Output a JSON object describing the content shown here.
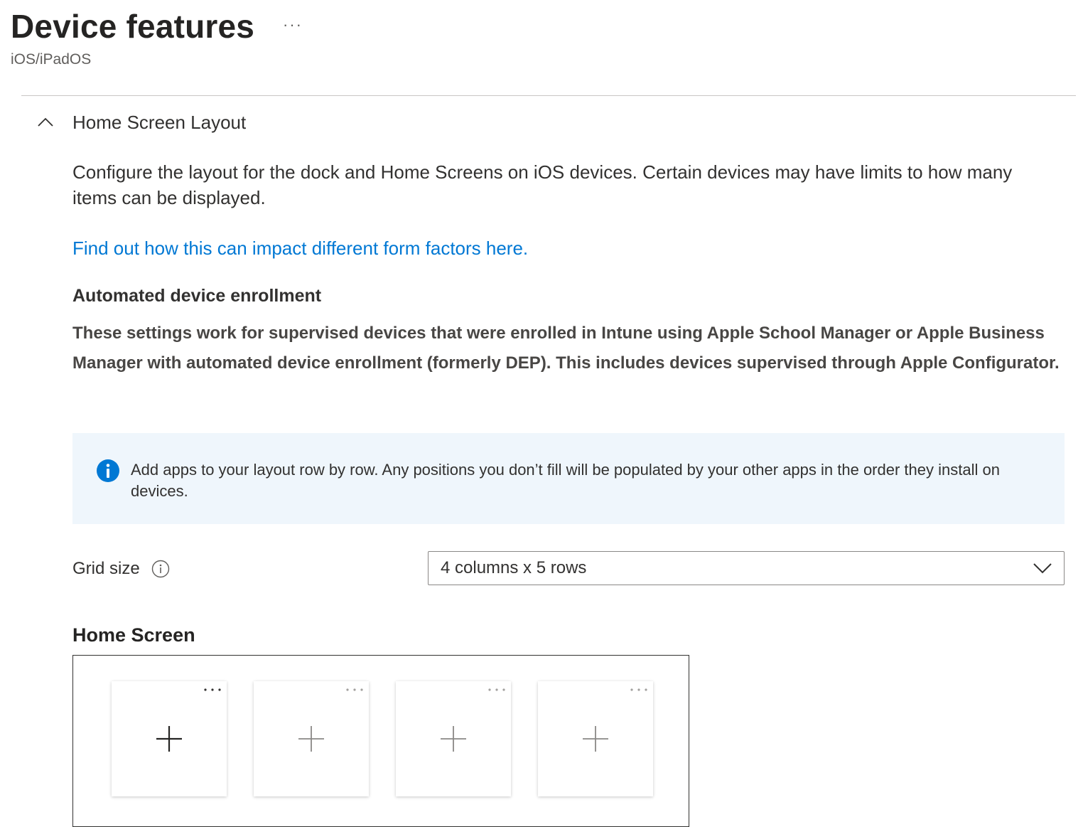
{
  "header": {
    "title": "Device features",
    "more_label": "···",
    "subtitle": "iOS/iPadOS"
  },
  "section": {
    "title": "Home Screen Layout",
    "expanded": true,
    "description": "Configure the layout for the dock and Home Screens on iOS devices. Certain devices may have limits to how many items can be displayed.",
    "link_text": "Find out how this can impact different form factors here.",
    "ade_heading": "Automated device enrollment",
    "ade_text": "These settings work for supervised devices that were enrolled in Intune using Apple School Manager or Apple Business Manager with automated device enrollment (formerly DEP). This includes devices supervised through Apple Configurator.",
    "info_text": "Add apps to your layout row by row. Any positions you don’t fill will be populated by your other apps in the order they install on devices."
  },
  "grid_size": {
    "label": "Grid size",
    "value": "4 columns x 5 rows"
  },
  "home_screen": {
    "heading": "Home Screen",
    "tiles": [
      {
        "active": true,
        "icon": "plus-icon"
      },
      {
        "active": false,
        "icon": "plus-icon"
      },
      {
        "active": false,
        "icon": "plus-icon"
      },
      {
        "active": false,
        "icon": "plus-icon"
      }
    ]
  },
  "colors": {
    "link": "#0078d4",
    "info_background": "#eff6fc",
    "info_icon": "#0078d4"
  }
}
